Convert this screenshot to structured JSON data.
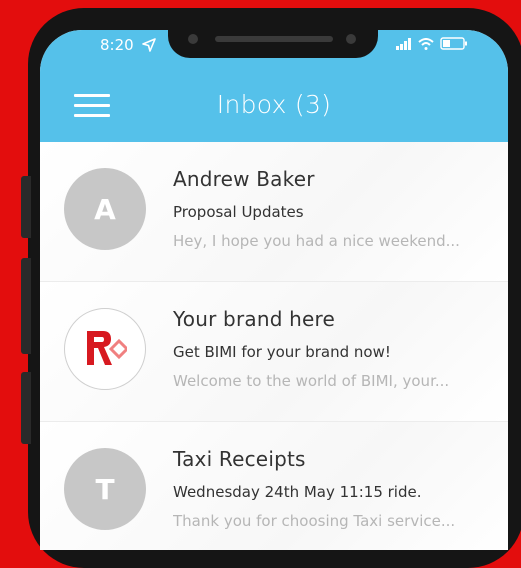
{
  "status_bar": {
    "time": "8:20"
  },
  "header": {
    "title": "Inbox (3)"
  },
  "emails": [
    {
      "avatar_letter": "A",
      "sender": "Andrew Baker",
      "subject": "Proposal Updates",
      "preview": "Hey, I hope you had a nice weekend..."
    },
    {
      "avatar_letter": "",
      "sender": "Your brand here",
      "subject": "Get BIMI for your brand now!",
      "preview": "Welcome to the world of BIMI, your..."
    },
    {
      "avatar_letter": "T",
      "sender": "Taxi Receipts",
      "subject": "Wednesday 24th May 11:15 ride.",
      "preview": "Thank you for choosing Taxi service..."
    }
  ],
  "colors": {
    "background": "#e30d0d",
    "header": "#55c1ea",
    "avatar": "#c7c7c7",
    "brand_red": "#d71920"
  }
}
